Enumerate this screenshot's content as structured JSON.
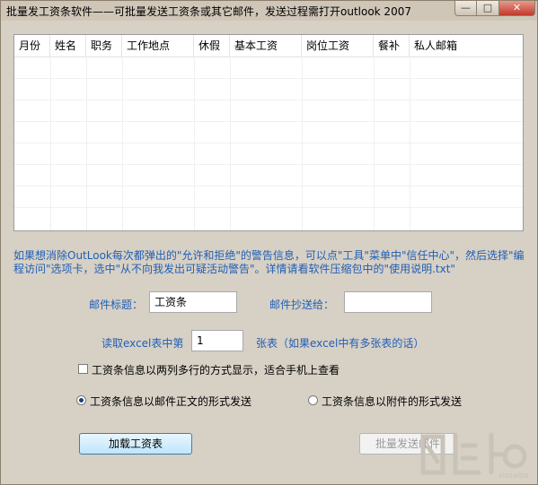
{
  "window": {
    "title": "批量发工资条软件——可批量发送工资条或其它邮件，发送过程需打开outlook 2007",
    "controls": {
      "minimize": "—",
      "maximize": "□",
      "close": "✕"
    }
  },
  "grid": {
    "columns": [
      "月份",
      "姓名",
      "职务",
      "工作地点",
      "休假",
      "基本工资",
      "岗位工资",
      "餐补",
      "私人邮箱"
    ]
  },
  "note": "如果想消除OutLook每次都弹出的\"允许和拒绝\"的警告信息，可以点\"工具\"菜单中\"信任中心\"，然后选择\"编程访问\"选项卡，选中\"从不向我发出可疑活动警告\"。详情请看软件压缩包中的\"使用说明.txt\"",
  "form": {
    "subject_label": "邮件标题：",
    "subject_value": "工资条",
    "cc_label": "邮件抄送给：",
    "cc_value": "",
    "sheet_label": "读取excel表中第",
    "sheet_value": "1",
    "sheet_suffix": "张表（如果excel中有多张表的话）",
    "two_rows_option": "工资条信息以两列多行的方式显示，适合手机上查看",
    "radio_body": "工资条信息以邮件正文的形式发送",
    "radio_attach": "工资条信息以附件的形式发送"
  },
  "buttons": {
    "load": "加载工资表",
    "send": "批量发送邮件"
  },
  "watermark": "下载吧"
}
